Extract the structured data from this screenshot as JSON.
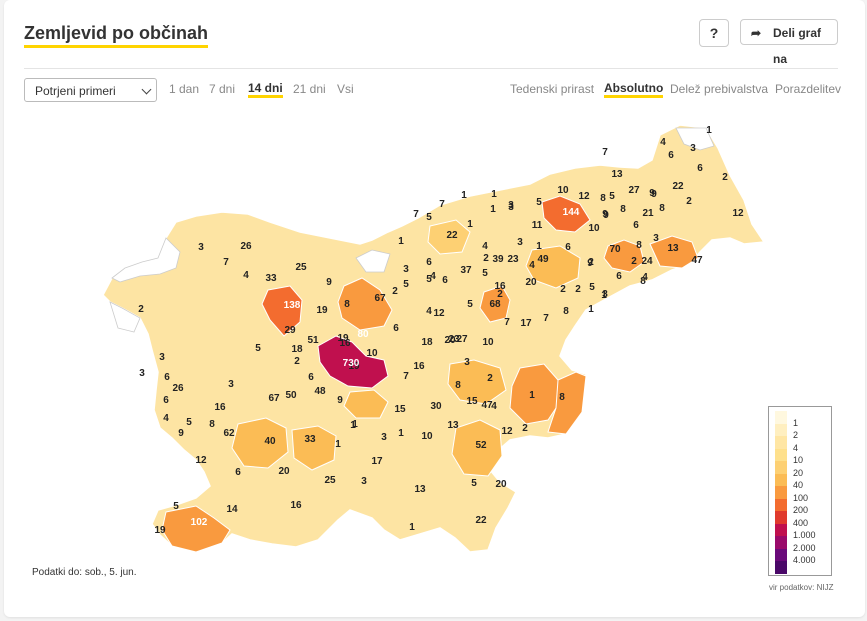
{
  "header": {
    "title": "Zemljevid po občinah",
    "help_label": "?",
    "share_label": "Deli graf na"
  },
  "controls": {
    "select_value": "Potrjeni primeri",
    "periods": [
      "1 dan",
      "7 dni",
      "14 dni",
      "21 dni",
      "Vsi"
    ],
    "period_active": "14 dni",
    "measures": [
      "Tedenski prirast",
      "Absolutno",
      "Delež prebivalstva",
      "Porazdelitev"
    ],
    "measure_active": "Absolutno"
  },
  "legend": {
    "labels": [
      "1",
      "2",
      "4",
      "10",
      "20",
      "40",
      "100",
      "200",
      "400",
      "1.000",
      "2.000",
      "4.000"
    ],
    "colors": [
      "#fff8df",
      "#ffefc0",
      "#ffe6a4",
      "#fee08c",
      "#fdd073",
      "#fbbc55",
      "#f99a3f",
      "#f36c2f",
      "#e03a2d",
      "#c0104e",
      "#9a0a6a",
      "#6a0a7a",
      "#4a0868"
    ]
  },
  "footer": {
    "data_date": "Podatki do: sob., 5. jun.",
    "source": "vir podatkov: NIJZ"
  },
  "map_values": [
    "1",
    "4",
    "6",
    "2",
    "6",
    "3",
    "8",
    "7",
    "12",
    "22",
    "9",
    "2",
    "13",
    "5",
    "27",
    "9",
    "10",
    "12",
    "8",
    "9",
    "8",
    "21",
    "144",
    "10",
    "9",
    "6",
    "5",
    "3",
    "1",
    "7",
    "5",
    "7",
    "1",
    "1",
    "3",
    "11",
    "22",
    "1",
    "4",
    "3",
    "26",
    "7",
    "4",
    "3",
    "33",
    "25",
    "1",
    "3",
    "6",
    "70",
    "8",
    "2",
    "24",
    "13",
    "47",
    "4",
    "2",
    "3",
    "1",
    "39",
    "23",
    "49",
    "4",
    "5",
    "2",
    "6",
    "9",
    "37",
    "20",
    "2",
    "2",
    "5",
    "1",
    "16",
    "8",
    "5",
    "6",
    "3",
    "9",
    "5",
    "6",
    "1",
    "8",
    "67",
    "2",
    "19",
    "138",
    "4",
    "2",
    "19",
    "8",
    "68",
    "7",
    "17",
    "7",
    "12",
    "4",
    "5",
    "18",
    "23",
    "20",
    "27",
    "10",
    "29",
    "51",
    "16",
    "80",
    "6",
    "19",
    "5",
    "18",
    "10",
    "730",
    "16",
    "7",
    "2",
    "6",
    "3",
    "3",
    "26",
    "50",
    "48",
    "8",
    "15",
    "47",
    "4",
    "2",
    "1",
    "8",
    "67",
    "62",
    "16",
    "9",
    "15",
    "30",
    "13",
    "12",
    "2",
    "5",
    "4",
    "40",
    "33",
    "1",
    "3",
    "10",
    "52",
    "12",
    "6",
    "20",
    "1",
    "17",
    "25",
    "13",
    "5",
    "20",
    "16",
    "3",
    "22",
    "5",
    "14",
    "102",
    "19",
    "1",
    "1",
    "6",
    "9",
    "8",
    "6",
    "3",
    "3",
    "2",
    "1"
  ]
}
